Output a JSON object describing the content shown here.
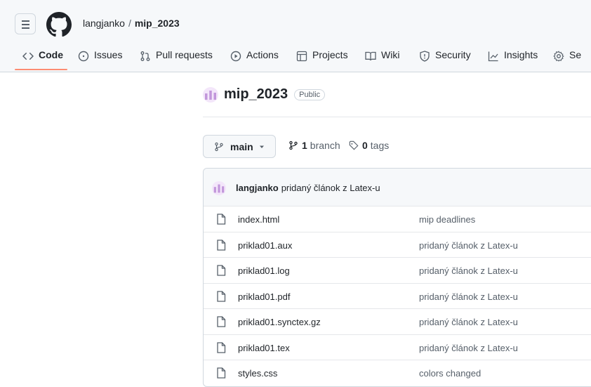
{
  "header": {
    "owner": "langjanko",
    "separator": "/",
    "repo": "mip_2023"
  },
  "tabs": [
    {
      "label": "Code",
      "icon": "code-icon",
      "selected": true
    },
    {
      "label": "Issues",
      "icon": "issue-opened-icon"
    },
    {
      "label": "Pull requests",
      "icon": "git-pull-request-icon"
    },
    {
      "label": "Actions",
      "icon": "play-icon"
    },
    {
      "label": "Projects",
      "icon": "table-icon"
    },
    {
      "label": "Wiki",
      "icon": "book-icon"
    },
    {
      "label": "Security",
      "icon": "shield-icon"
    },
    {
      "label": "Insights",
      "icon": "graph-icon"
    },
    {
      "label": "Se",
      "icon": "gear-icon"
    }
  ],
  "repo_title": {
    "name": "mip_2023",
    "visibility": "Public"
  },
  "branch": {
    "current": "main",
    "branch_count": "1",
    "branch_label": "branch",
    "tag_count": "0",
    "tag_label": "tags"
  },
  "latest_commit": {
    "author": "langjanko",
    "message": "pridaný článok z Latex-u"
  },
  "files": [
    {
      "name": "index.html",
      "message": "mip deadlines"
    },
    {
      "name": "priklad01.aux",
      "message": "pridaný článok z Latex-u"
    },
    {
      "name": "priklad01.log",
      "message": "pridaný článok z Latex-u"
    },
    {
      "name": "priklad01.pdf",
      "message": "pridaný článok z Latex-u"
    },
    {
      "name": "priklad01.synctex.gz",
      "message": "pridaný článok z Latex-u"
    },
    {
      "name": "priklad01.tex",
      "message": "pridaný článok z Latex-u"
    },
    {
      "name": "styles.css",
      "message": "colors changed"
    }
  ],
  "colors": {
    "accent_underline": "#fd8c73",
    "avatar_purple": "#c297db"
  }
}
